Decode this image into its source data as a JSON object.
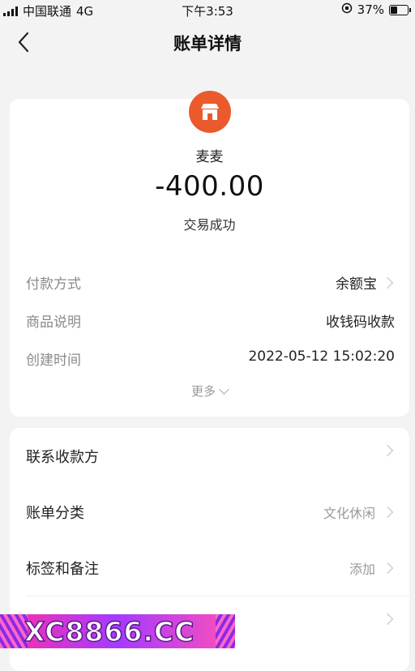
{
  "status_bar": {
    "carrier": "中国联通",
    "network": "4G",
    "time": "下午3:53",
    "battery_text": "37%",
    "battery_level": 0.37
  },
  "header": {
    "title": "账单详情",
    "back_icon": "chevron-left-icon"
  },
  "bill": {
    "merchant_icon": "shop-icon",
    "merchant_color": "#ea5a2c",
    "merchant_name": "麦麦",
    "amount": "-400.00",
    "status": "交易成功",
    "details": [
      {
        "label": "付款方式",
        "value": "余额宝",
        "has_arrow": true
      },
      {
        "label": "商品说明",
        "value": "收钱码收款",
        "has_arrow": false
      },
      {
        "label": "创建时间",
        "value": "2022-05-12 15:02:20",
        "has_arrow": false
      }
    ],
    "more_label": "更多"
  },
  "actions": [
    {
      "label": "联系收款方",
      "value": ""
    },
    {
      "label": "账单分类",
      "value": "文化休闲"
    },
    {
      "label": "标签和备注",
      "value": "添加"
    },
    {
      "label": "",
      "value": ""
    }
  ],
  "watermark": {
    "text": "XC8866.CC"
  }
}
